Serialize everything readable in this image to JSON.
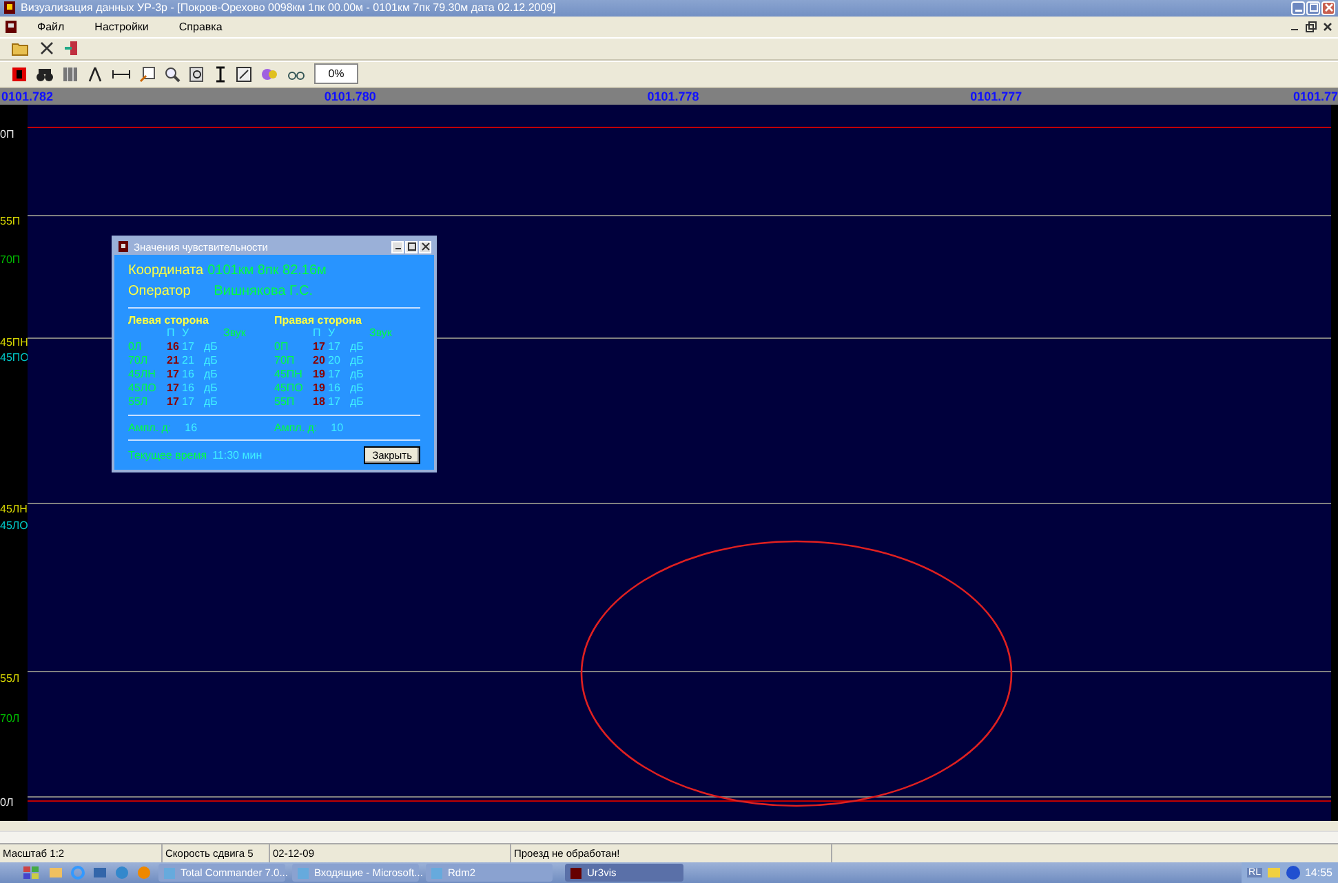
{
  "window": {
    "title": "Визуализация данных УР-3р - [Покров-Орехово 0098км 1пк 00.00м - 0101км 7пк 79.30м дата 02.12.2009]"
  },
  "menu": [
    "Файл",
    "Настройки",
    "Справка"
  ],
  "toolbar": {
    "zoom_value": "0%"
  },
  "ruler": [
    "0101.782",
    "0101.780",
    "0101.778",
    "0101.777",
    "0101.77"
  ],
  "channels": [
    {
      "label": "0П",
      "color": "#e8e8e8"
    },
    {
      "label": "55П",
      "color": "#d8d800"
    },
    {
      "label": "70П",
      "color": "#00c000"
    },
    {
      "label": "45ПН",
      "color": "#d8d800"
    },
    {
      "label": "45ПО",
      "color": "#00c8c8"
    },
    {
      "label": "45ЛН",
      "color": "#d8d800"
    },
    {
      "label": "45ЛО",
      "color": "#00c8c8"
    },
    {
      "label": "55Л",
      "color": "#d8d800"
    },
    {
      "label": "70Л",
      "color": "#00c000"
    },
    {
      "label": "0Л",
      "color": "#e8e8e8"
    }
  ],
  "dialog": {
    "title": "Значения чувствительности",
    "coordinate_label": "Координата",
    "coordinate_value": "0101км 8пк 82.16м",
    "operator_label": "Оператор",
    "operator_value": "Вишнякова Г.С.",
    "sides": [
      {
        "title": "Левая сторона",
        "headers": [
          "П",
          "У",
          "Звук"
        ],
        "rows": [
          {
            "name": "0Л",
            "p": "16",
            "u": "17",
            "unit": "дБ"
          },
          {
            "name": "70Л",
            "p": "21",
            "u": "21",
            "unit": "дБ"
          },
          {
            "name": "45ЛН",
            "p": "17",
            "u": "16",
            "unit": "дБ"
          },
          {
            "name": "45ЛО",
            "p": "17",
            "u": "16",
            "unit": "дБ"
          },
          {
            "name": "55Л",
            "p": "17",
            "u": "17",
            "unit": "дБ"
          }
        ],
        "ampl_label": "Ампл. д:",
        "ampl_value": "16"
      },
      {
        "title": "Правая сторона",
        "headers": [
          "П",
          "У",
          "Звук"
        ],
        "rows": [
          {
            "name": "0П",
            "p": "17",
            "u": "17",
            "unit": "дБ"
          },
          {
            "name": "70П",
            "p": "20",
            "u": "20",
            "unit": "дБ"
          },
          {
            "name": "45ПН",
            "p": "19",
            "u": "17",
            "unit": "дБ"
          },
          {
            "name": "45ПО",
            "p": "19",
            "u": "16",
            "unit": "дБ"
          },
          {
            "name": "55П",
            "p": "18",
            "u": "17",
            "unit": "дБ"
          }
        ],
        "ampl_label": "Ампл. д:",
        "ampl_value": "10"
      }
    ],
    "time_label": "Текущее время",
    "time_value": "11:30 мин",
    "close_button": "Закрыть"
  },
  "status_bar": [
    "Масштаб 1:2",
    "Скорость сдвига 5",
    "02-12-09",
    "Проезд не обработан!"
  ],
  "taskbar": {
    "tasks": [
      {
        "label": "Total Commander 7.0...",
        "selected": false
      },
      {
        "label": "Входящие - Microsoft...",
        "selected": false
      },
      {
        "label": "Rdm2",
        "selected": false
      },
      {
        "label": "Ur3vis",
        "selected": true
      }
    ],
    "language": "RL",
    "clock": "14:55"
  }
}
